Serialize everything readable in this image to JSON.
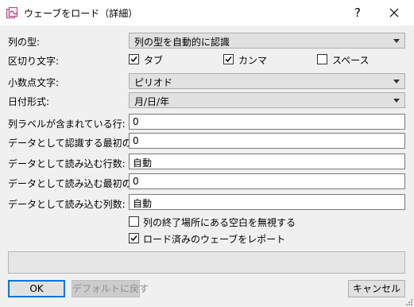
{
  "window": {
    "title": "ウェーブをロード（詳細）",
    "help_label": "?",
    "icons": {
      "app": "load-wave-icon",
      "close": "close-icon"
    }
  },
  "form": {
    "column_type": {
      "label": "列の型:",
      "value": "列の型を自動的に認識"
    },
    "delimiter": {
      "label": "区切り文字:",
      "options": [
        {
          "label": "タブ",
          "checked": true
        },
        {
          "label": "カンマ",
          "checked": true
        },
        {
          "label": "スペース",
          "checked": false
        }
      ]
    },
    "decimal": {
      "label": "小数点文字:",
      "value": "ピリオド"
    },
    "date_format": {
      "label": "日付形式:",
      "value": "月/日/年"
    },
    "label_row": {
      "label": "列ラベルが含まれている行:",
      "value": "0"
    },
    "first_data_row": {
      "label": "データとして認識する最初の行:",
      "value": "0"
    },
    "rows_to_load": {
      "label": "データとして読み込む行数:",
      "value": "自動"
    },
    "first_column": {
      "label": "データとして読み込む最初の列:",
      "value": "0"
    },
    "columns_to_load": {
      "label": "データとして読み込む列数:",
      "value": "自動"
    },
    "ignore_blanks": {
      "label": "列の終了場所にある空白を無視する",
      "checked": false
    },
    "report_waves": {
      "label": "ロード済みのウェーブをレポート",
      "checked": true
    }
  },
  "status": {
    "text": ""
  },
  "buttons": {
    "ok": "OK",
    "defaults": "デフォルトに戻す",
    "cancel": "キャンセル"
  }
}
